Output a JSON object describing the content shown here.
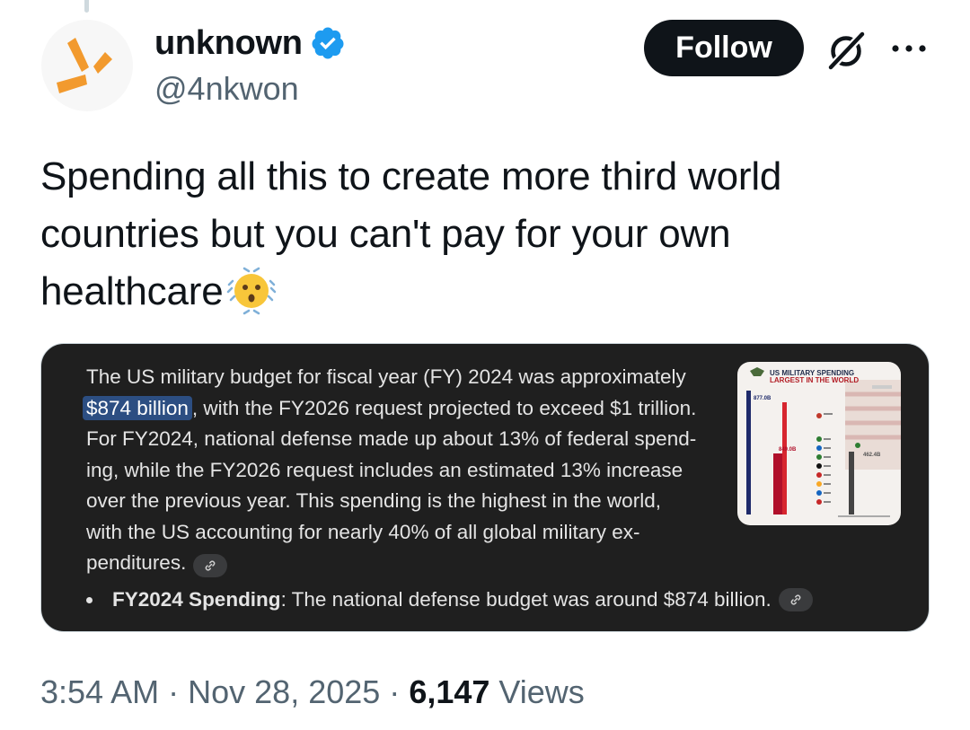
{
  "author": {
    "display_name": "unknown",
    "handle": "@4nkwon",
    "verified": true
  },
  "actions": {
    "follow_label": "Follow",
    "grok_icon": "grok-icon",
    "more_icon": "more-icon"
  },
  "tweet": {
    "text_lines": [
      "Spending all this to create more third world",
      "countries but you can't pay for your own",
      "healthcare"
    ],
    "emoji": "shaking-face"
  },
  "media": {
    "highlight": "$874 billion",
    "lines": [
      "The US military budget for fiscal year (FY) 2024 was approximately",
      ", with the FY2026 request projected to exceed $1 trillion.",
      "For FY2024, national defense made up about 13% of federal spend-",
      "ing, while the FY2026 request includes an estimated 13% increase",
      "over the previous year. This spending is the highest in the world,",
      "with the US accounting for nearly 40% of all global military ex-",
      "penditures."
    ],
    "bullet_bold": "FY2024 Spending",
    "bullet_text": ": The national defense budget was around $874 billion.",
    "thumbnail": {
      "title_line1": "US MILITARY SPENDING",
      "title_line2": "LARGEST IN THE WORLD",
      "left_label": "877.0B",
      "mid_label": "849.0B",
      "right_label": "462.4B"
    }
  },
  "meta": {
    "time": "3:54 AM",
    "separator": "·",
    "date": "Nov 28, 2025",
    "views_count": "6,147",
    "views_label": "Views"
  },
  "colors": {
    "follow_bg": "#0f1419",
    "verified_blue": "#1d9bf0",
    "muted_text": "#536471",
    "card_bg": "#1f1f1f",
    "highlight_bg": "#2c4e82"
  }
}
